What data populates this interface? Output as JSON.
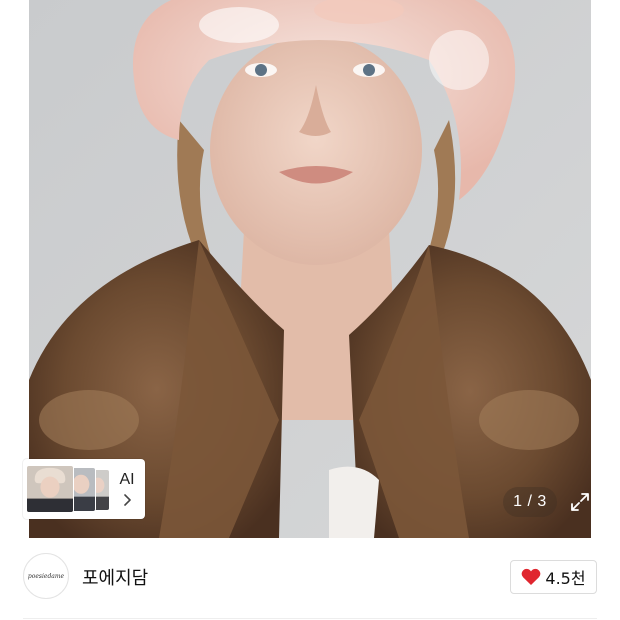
{
  "gallery": {
    "counter_text": "1 / 3",
    "expand_icon": "expand-icon",
    "ai_chip": {
      "label": "AI",
      "chevron_icon": "chevron-right-icon"
    }
  },
  "seller": {
    "avatar_text": "poesiedame",
    "name": "포에지담",
    "like": {
      "icon": "heart-icon",
      "icon_color": "#e0262f",
      "count_text": "4.5천"
    }
  }
}
